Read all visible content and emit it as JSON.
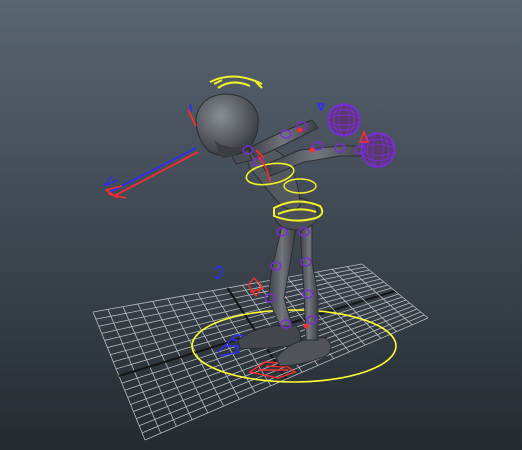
{
  "viewport": {
    "background_top": "#5a6572",
    "background_bottom": "#242b31"
  },
  "colors": {
    "grid_line": "#b8bcc0",
    "grid_axis": "#141414",
    "root_circle": "#ffff33",
    "controller_yellow": "#f2f22a",
    "controller_red": "#ff2c2c",
    "controller_blue": "#2c2cff",
    "joint_purple": "#7a2cd8",
    "mesh_dark": "#3c3f45",
    "mesh_mid": "#54585f",
    "mesh_light": "#777b82"
  },
  "scene": {
    "grid": {
      "divisions": 18
    },
    "character": {
      "pose": "leaning-forward-arms-extended"
    },
    "manipulators": [
      "root-circle",
      "head-control",
      "chest-control",
      "hip-control",
      "hand-controls",
      "foot-controls",
      "ik-handle-arrow"
    ]
  }
}
